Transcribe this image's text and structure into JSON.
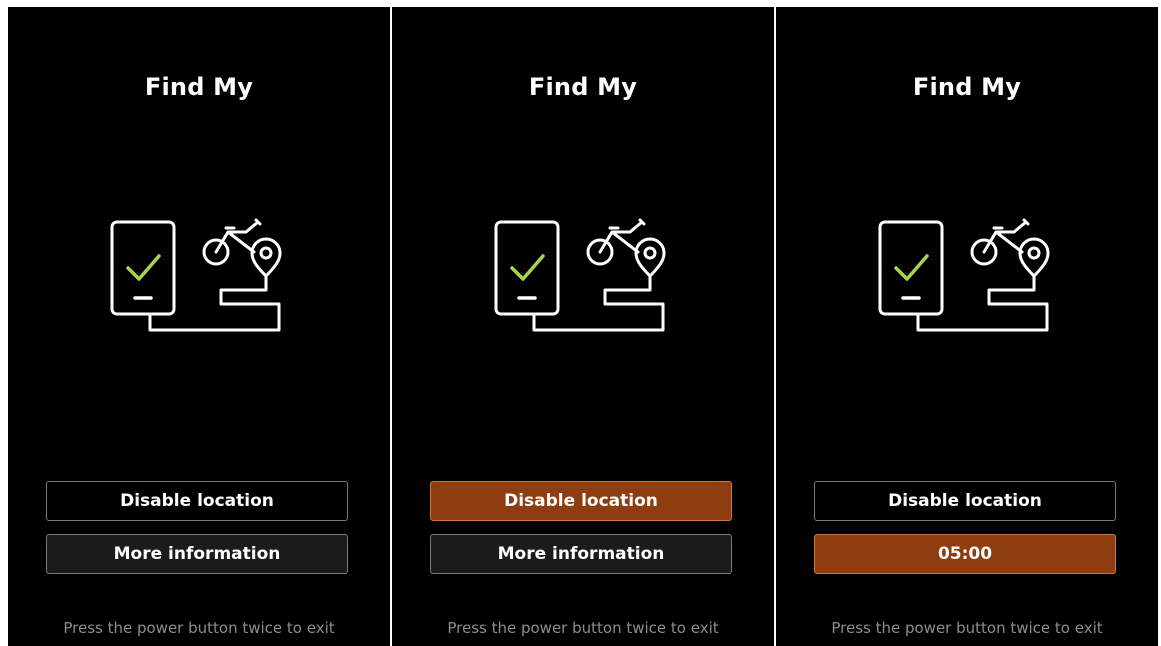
{
  "panels": [
    {
      "title": "Find My",
      "button1": "Disable location",
      "button2": "More information",
      "footer": "Press the power button twice to exit"
    },
    {
      "title": "Find My",
      "button1": "Disable location",
      "button2": "More information",
      "footer": "Press the power button twice to exit"
    },
    {
      "title": "Find My",
      "button1": "Disable location",
      "button2": "05:00",
      "footer": "Press the power button twice to exit"
    }
  ],
  "icons": [
    "phone-icon",
    "check-icon",
    "bike-icon",
    "location-pin-icon",
    "cable-icon"
  ],
  "colors": {
    "background": "#000000",
    "selected_button": "#8d3d10",
    "selected_border": "#c9773a",
    "check": "#a6d64a",
    "text": "#ffffff",
    "footer_text": "#8d8d8d"
  }
}
